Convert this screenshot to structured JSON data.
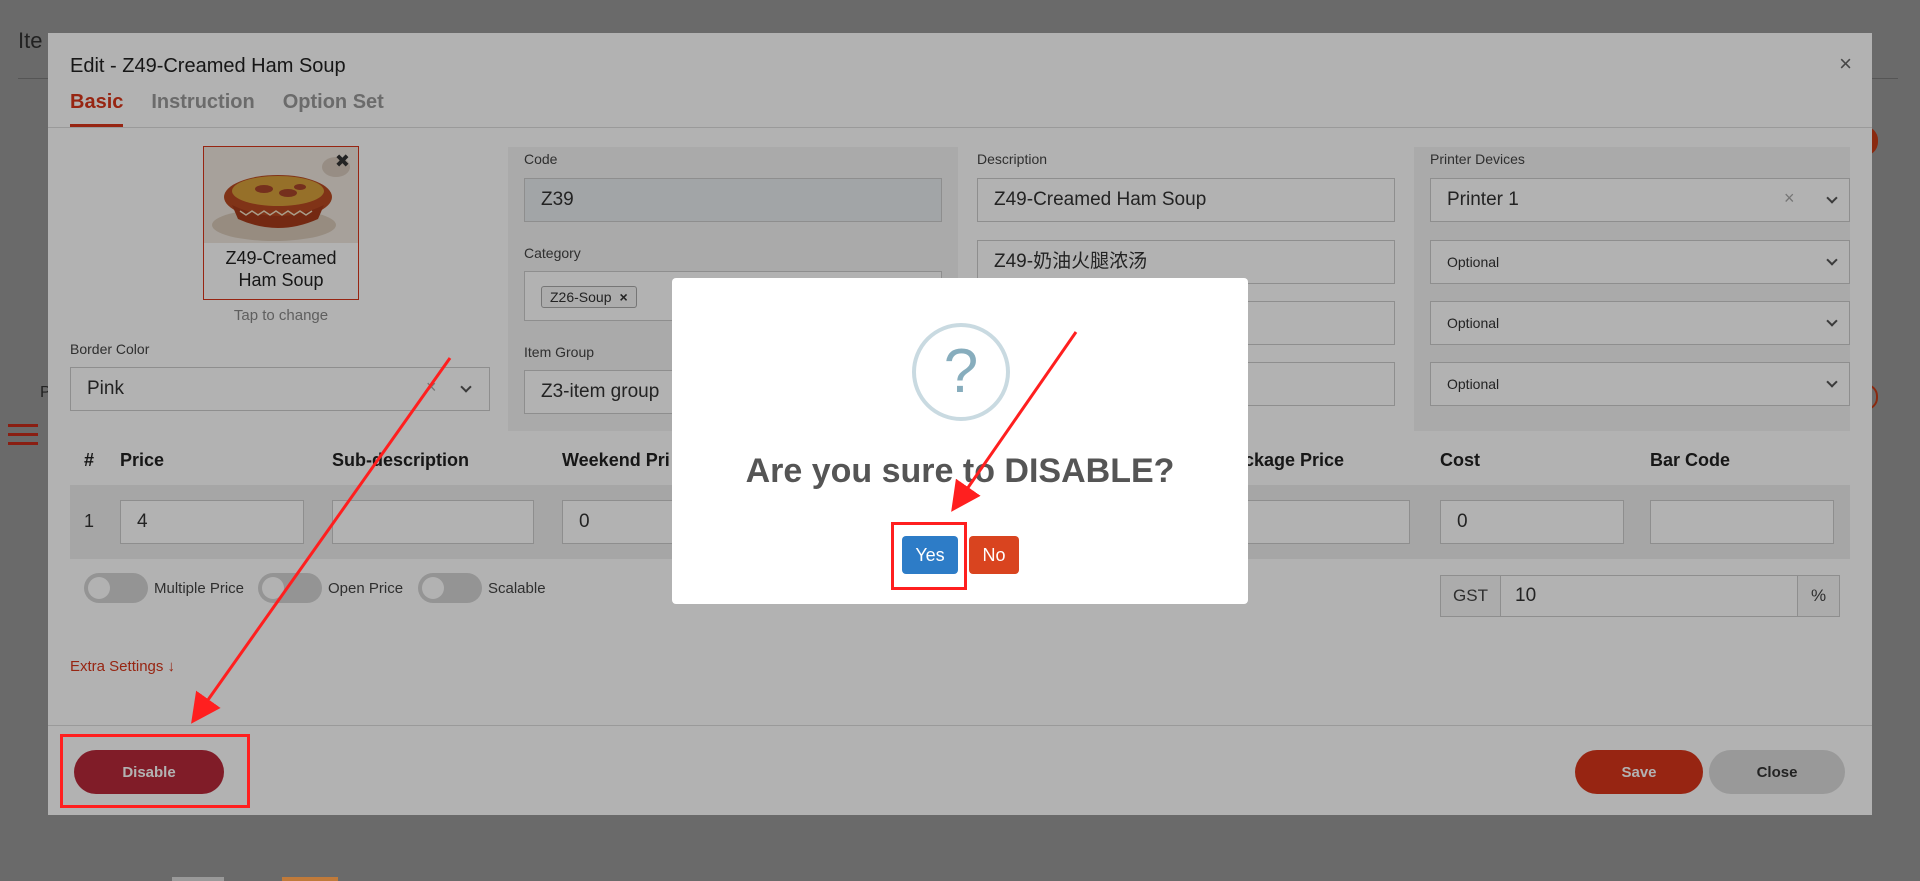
{
  "background": {
    "page_title": "Ite",
    "side_letter": "P"
  },
  "modal": {
    "title": "Edit - Z49-Creamed Ham Soup",
    "close_symbol": "×",
    "tabs": [
      {
        "label": "Basic",
        "active": true
      },
      {
        "label": "Instruction",
        "active": false
      },
      {
        "label": "Option Set",
        "active": false
      }
    ],
    "image": {
      "caption": "Z49-Creamed Ham Soup",
      "remove_symbol": "✖",
      "tap_hint": "Tap to change"
    },
    "border_color": {
      "label": "Border Color",
      "value": "Pink",
      "clear_symbol": "×"
    },
    "code": {
      "label": "Code",
      "value": "Z39"
    },
    "category": {
      "label": "Category",
      "tag": "Z26-Soup",
      "tag_remove": "×"
    },
    "item_group": {
      "label": "Item Group",
      "value": "Z3-item group"
    },
    "description": {
      "label": "Description",
      "values": [
        "Z49-Creamed Ham Soup",
        "Z49-奶油火腿浓汤",
        "",
        ""
      ]
    },
    "printer_devices": {
      "label": "Printer Devices",
      "values": [
        "Printer 1",
        "Optional",
        "Optional",
        "Optional"
      ],
      "clear_symbol": "×"
    },
    "price_table": {
      "headers": [
        "#",
        "Price",
        "Sub-description",
        "Weekend Pri",
        "ckage Price",
        "Cost",
        "Bar Code"
      ],
      "row": {
        "num": "1",
        "price": "4",
        "sub_description": "",
        "weekend_price": "0",
        "package_price": "",
        "cost": "0",
        "bar_code": ""
      }
    },
    "toggles": [
      {
        "label": "Multiple Price",
        "on": false
      },
      {
        "label": "Open Price",
        "on": false
      },
      {
        "label": "Scalable",
        "on": false
      }
    ],
    "gst": {
      "label": "GST",
      "value": "10",
      "suffix": "%"
    },
    "extra_settings": "Extra Settings ↓",
    "buttons": {
      "disable": "Disable",
      "save": "Save",
      "close": "Close"
    }
  },
  "confirm": {
    "icon": "?",
    "title": "Are you sure to DISABLE?",
    "yes": "Yes",
    "no": "No"
  },
  "colors": {
    "accent": "#d9361a",
    "disable": "#b8293a",
    "yes": "#2d7cc7",
    "no": "#d9441f",
    "annotation": "#ff1f1f"
  }
}
